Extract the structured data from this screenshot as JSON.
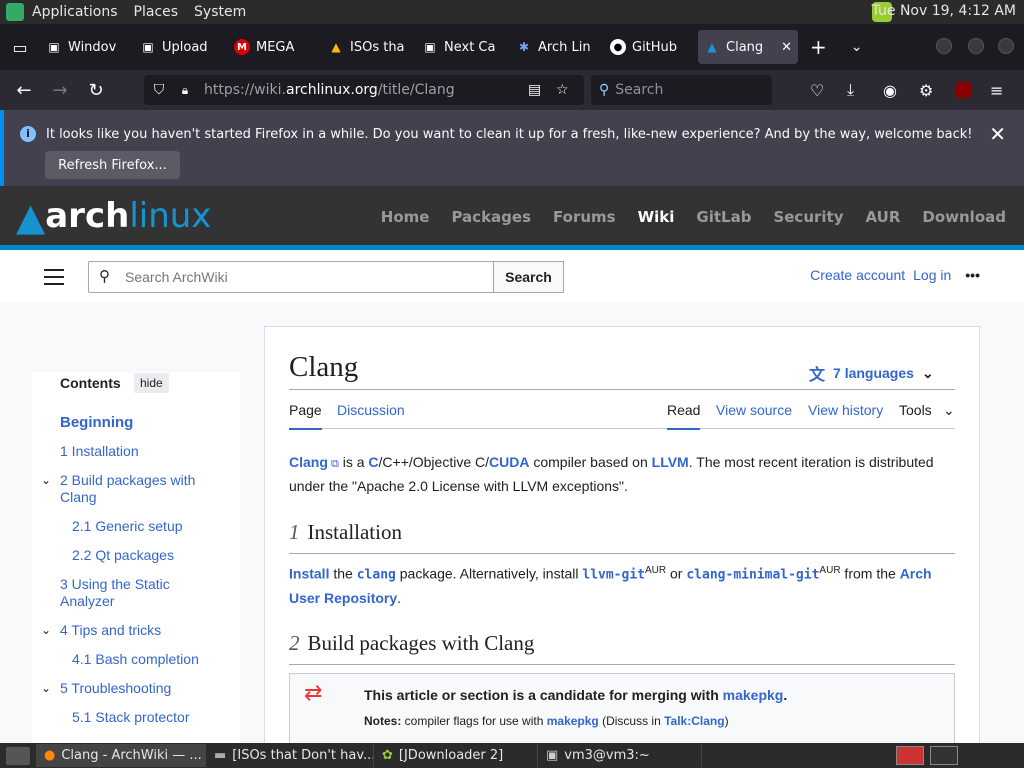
{
  "gnome_panel": {
    "menus": [
      "Applications",
      "Places",
      "System"
    ],
    "clock": "Tue Nov 19, 4:12 AM"
  },
  "browser": {
    "tabs": [
      {
        "label": "Windov",
        "icon": "doc-icon"
      },
      {
        "label": "Upload",
        "icon": "doc-icon"
      },
      {
        "label": "MEGA",
        "icon": "mega-icon"
      },
      {
        "label": "ISOs tha",
        "icon": "drive-icon"
      },
      {
        "label": "Next Ca",
        "icon": "doc-icon"
      },
      {
        "label": "Arch Lin",
        "icon": "arch-icon"
      },
      {
        "label": "GitHub",
        "icon": "github-icon"
      },
      {
        "label": "Clang",
        "icon": "arch-icon"
      }
    ],
    "url_prefix": "https://wiki.",
    "url_domain": "archlinux.org",
    "url_path": "/title/Clang",
    "search_placeholder": "Search",
    "notification": {
      "message": "It looks like you haven't started Firefox in a while. Do you want to clean it up for a fresh, like-new experience? And by the way, welcome back!",
      "button": "Refresh Firefox..."
    }
  },
  "arch": {
    "logo_a": "arch",
    "logo_b": "linux",
    "nav": [
      "Home",
      "Packages",
      "Forums",
      "Wiki",
      "GitLab",
      "Security",
      "AUR",
      "Download"
    ],
    "active_nav": "Wiki"
  },
  "wiki": {
    "search_placeholder": "Search ArchWiki",
    "search_button": "Search",
    "create_account": "Create account",
    "login": "Log in",
    "toc": {
      "title": "Contents",
      "hide": "hide",
      "items": [
        {
          "label": "Beginning"
        },
        {
          "label": "1  Installation"
        },
        {
          "label": "2  Build packages with Clang"
        },
        {
          "label": "2.1  Generic setup"
        },
        {
          "label": "2.2  Qt packages"
        },
        {
          "label": "3  Using the Static Analyzer"
        },
        {
          "label": "4  Tips and tricks"
        },
        {
          "label": "4.1  Bash completion"
        },
        {
          "label": "5  Troubleshooting"
        },
        {
          "label": "5.1  Stack protector"
        }
      ]
    },
    "title": "Clang",
    "languages": "7 languages",
    "tabs_left": [
      "Page",
      "Discussion"
    ],
    "tabs_right": [
      "Read",
      "View source",
      "View history",
      "Tools"
    ],
    "intro": {
      "clang": "Clang",
      "t1": " is a ",
      "c": "C",
      "t2": "/C++/Objective C/",
      "cuda": "CUDA",
      "t3": " compiler based on ",
      "llvm": "LLVM",
      "t4": ". The most recent iteration is distributed under the \"Apache 2.0 License with LLVM exceptions\"."
    },
    "sec1": {
      "num": "1",
      "title": "Installation"
    },
    "install": {
      "install": "Install",
      "t1": " the ",
      "pkg": "clang",
      "t2": " package. Alternatively, install ",
      "aur1": "llvm-git",
      "sup": "AUR",
      "t3": " or ",
      "aur2": "clang-minimal-git",
      "t4": " from the ",
      "aurlink": "Arch User Repository",
      "t5": "."
    },
    "sec2": {
      "num": "2",
      "title": "Build packages with Clang"
    },
    "merge": {
      "bold": "This article or section is a candidate for merging with ",
      "target": "makepkg",
      "notes_label": "Notes:",
      "notes_text": " compiler flags for use with ",
      "notes_link": "makepkg",
      "discuss": " (Discuss in ",
      "talk": "Talk:Clang",
      "end": ")"
    }
  },
  "taskbar": {
    "items": [
      "Clang - ArchWiki — ...",
      "[ISOs that Don't hav...",
      "[JDownloader 2]",
      "vm3@vm3:~"
    ]
  }
}
